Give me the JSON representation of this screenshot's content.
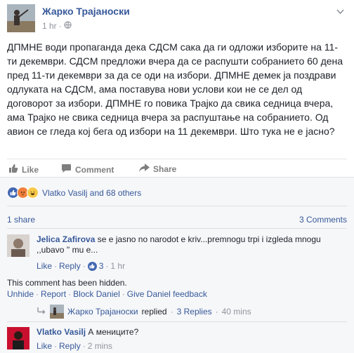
{
  "post": {
    "author": "Жарко Трајаноски",
    "time": "1 hr",
    "separator": "·",
    "audience_icon": "globe-icon",
    "text": "ДПМНЕ води пропаганда дека СДСМ сака да ги одложи изборите на 11-ти декември. СДСМ предложи вчера да се распушти собранието 60 дена пред 11-ти декември за да се оди на избори. ДПМНЕ демек ја поздрави одлуката на СДСМ, ама поставува нови услови кои не се дел од договорот за избори. ДПМНЕ го повика Трајко да свика седница вчера, ама Трајко не свика седница вчера за распуштање на собранието. Од авион се гледа кој бега од избори на 11 декември. Што тука не е јасно?"
  },
  "actions": {
    "like": "Like",
    "comment": "Comment",
    "share": "Share"
  },
  "reactions": {
    "text": "Vlatko Vasilj and 68 others",
    "types": [
      "like",
      "angry",
      "haha"
    ]
  },
  "counts": {
    "shares": "1 share",
    "comments": "3 Comments"
  },
  "comments": [
    {
      "name": "Jelica Zafirova",
      "text": "se e jasno no narodot e kriv...premnogu trpi i izgleda mnogu ,,ubavo '' mu e...",
      "like": "Like",
      "reply": "Reply",
      "likes": "3",
      "time": "1 hr"
    },
    {
      "name": "Vlatko Vasilj",
      "text": "А мениците?",
      "like": "Like",
      "reply": "Reply",
      "time": "2 mins"
    }
  ],
  "hidden": {
    "note": "This comment has been hidden.",
    "unhide": "Unhide",
    "report": "Report",
    "block": "Block Daniel",
    "feedback": "Give Daniel feedback"
  },
  "replies": {
    "name": "Жарко Трајаноски",
    "verb": "replied",
    "count": "3 Replies",
    "time": "40 mins"
  },
  "dot": "·",
  "colors": {
    "link": "#365899",
    "muted": "#90949c",
    "like_blue": "#4267b2"
  }
}
